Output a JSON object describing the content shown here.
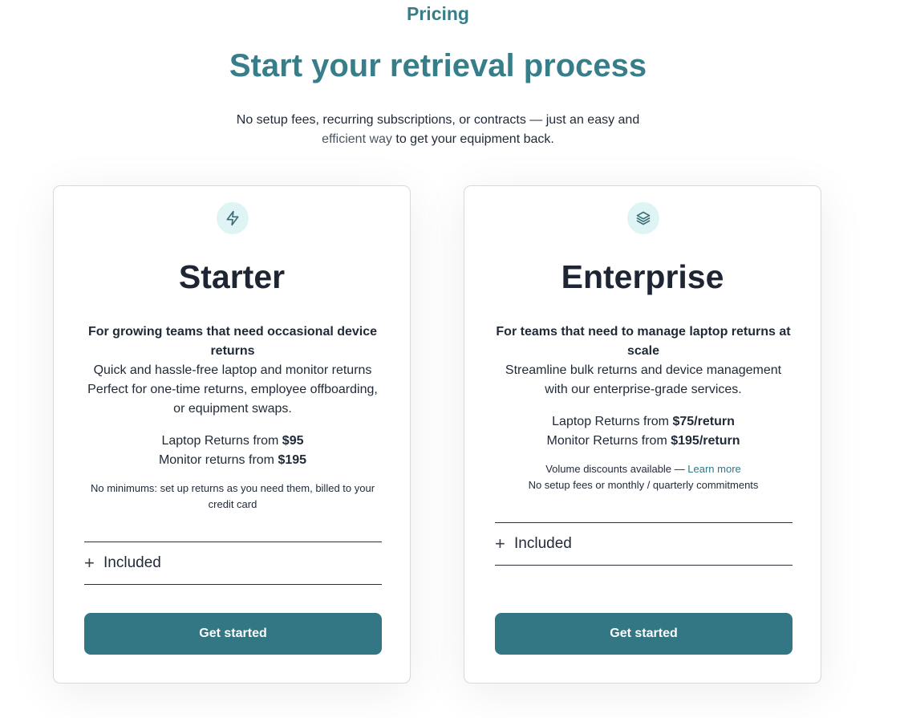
{
  "header": {
    "eyebrow": "Pricing",
    "title": "Start your retrieval process",
    "subtitle_main": "No setup fees, recurring subscriptions, or contracts — just an easy and",
    "subtitle_muted": "efficient way",
    "subtitle_end": "to get your equipment back."
  },
  "colors": {
    "accent": "#387e8a",
    "button": "#337784",
    "icon_bg": "#dff4f4",
    "link": "#2f7885"
  },
  "plans": [
    {
      "icon": "lightning-icon",
      "name": "Starter",
      "tagline": "For growing teams that need occasional device returns",
      "description": "Quick and hassle-free laptop and monitor returns Perfect for one-time returns, employee offboarding, or equipment swaps.",
      "laptop_label": "Laptop Returns from",
      "laptop_price": "$95",
      "monitor_label": "Monitor returns from",
      "monitor_price": "$195",
      "note": "No minimums: set up returns as you need them, billed to your credit card",
      "included_label": "Included",
      "cta_label": "Get started"
    },
    {
      "icon": "layers-icon",
      "name": "Enterprise",
      "tagline": "For teams that need to manage laptop returns at scale",
      "description": "Streamline bulk returns and device management with our enterprise-grade services.",
      "laptop_label": "Laptop Returns from",
      "laptop_price": "$75/return",
      "monitor_label": "Monitor Returns from",
      "monitor_price": "$195/return",
      "note_prefix": "Volume discounts available —",
      "note_link": "Learn more",
      "note_line2": "No setup fees or monthly / quarterly commitments",
      "included_label": "Included",
      "cta_label": "Get started"
    }
  ]
}
